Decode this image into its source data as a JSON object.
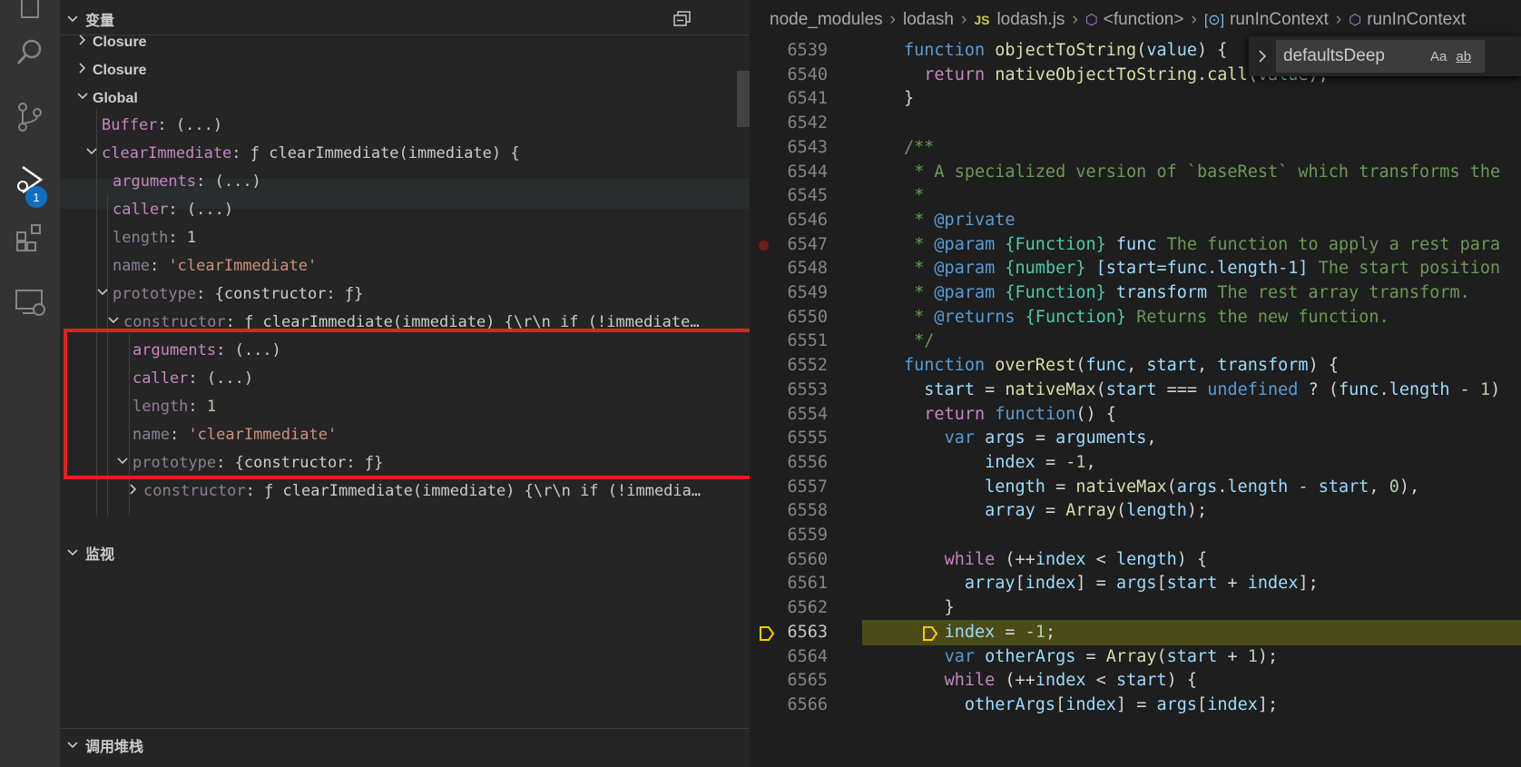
{
  "activity": {
    "badge": "1"
  },
  "variables_panel": {
    "header": "变量",
    "rows": [
      {
        "type": "scope",
        "label": "Closure"
      },
      {
        "type": "scope",
        "label": "Closure"
      },
      {
        "type": "scope",
        "label": "Global"
      },
      {
        "key": "Buffer",
        "value": "(...)"
      },
      {
        "key": "clearImmediate",
        "value": "ƒ clearImmediate(immediate) {"
      },
      {
        "key": "arguments",
        "value": "(...)"
      },
      {
        "key": "caller",
        "value": "(...)"
      },
      {
        "key": "length",
        "value": "1"
      },
      {
        "key": "name",
        "value": "'clearImmediate'"
      },
      {
        "key": "prototype",
        "value": "{constructor: ƒ}"
      },
      {
        "key": "constructor",
        "value": "ƒ clearImmediate(immediate) {\\r\\n  if (!immediate…"
      },
      {
        "key": "arguments",
        "value": "(...)"
      },
      {
        "key": "caller",
        "value": "(...)"
      },
      {
        "key": "length",
        "value": "1"
      },
      {
        "key": "name",
        "value": "'clearImmediate'"
      },
      {
        "key": "prototype",
        "value": "{constructor: ƒ}"
      },
      {
        "key": "constructor",
        "value": "ƒ clearImmediate(immediate) {\\r\\n  if (!immedia…"
      }
    ]
  },
  "watch_panel": {
    "header": "监视"
  },
  "callstack_panel": {
    "header": "调用堆栈"
  },
  "breadcrumb": {
    "items": [
      "node_modules",
      "lodash",
      "lodash.js",
      "<function>",
      "runInContext",
      "runInContext"
    ],
    "js_badge": "JS"
  },
  "find_widget": {
    "value": "defaultsDeep",
    "match_case": "Aa",
    "whole_word": "ab"
  },
  "code": {
    "line_numbers": [
      "6539",
      "6540",
      "6541",
      "6542",
      "6543",
      "6544",
      "6545",
      "6546",
      "6547",
      "6548",
      "6549",
      "6550",
      "6551",
      "6552",
      "6553",
      "6554",
      "6555",
      "6556",
      "6557",
      "6558",
      "6559",
      "6560",
      "6561",
      "6562",
      "6563",
      "6564",
      "6565",
      "6566"
    ],
    "breakpoint_line": "6547",
    "current_line": "6563",
    "lines": [
      [
        [
          "kw",
          "function "
        ],
        [
          "fn",
          "objectToString"
        ],
        [
          "pl",
          "("
        ],
        [
          "var",
          "value"
        ],
        [
          "pl",
          ") {"
        ]
      ],
      [
        [
          "pl",
          "  "
        ],
        [
          "ctl",
          "return "
        ],
        [
          "fn",
          "nativeObjectToString"
        ],
        [
          "pl",
          "."
        ],
        [
          "fn",
          "call"
        ],
        [
          "pl",
          "("
        ],
        [
          "var",
          "value"
        ],
        [
          "pl",
          ");"
        ]
      ],
      [
        [
          "pl",
          "}"
        ]
      ],
      [],
      [
        [
          "cm",
          "/**"
        ]
      ],
      [
        [
          "cm",
          " * A specialized version of `baseRest` which transforms the"
        ]
      ],
      [
        [
          "cm",
          " *"
        ]
      ],
      [
        [
          "cm",
          " * "
        ],
        [
          "doc",
          "@private"
        ]
      ],
      [
        [
          "cm",
          " * "
        ],
        [
          "doc",
          "@param "
        ],
        [
          "ty",
          "{Function} "
        ],
        [
          "var",
          "func "
        ],
        [
          "cm",
          "The function to apply a rest para"
        ]
      ],
      [
        [
          "cm",
          " * "
        ],
        [
          "doc",
          "@param "
        ],
        [
          "ty",
          "{number} "
        ],
        [
          "var",
          "[start=func.length-1] "
        ],
        [
          "cm",
          "The start position"
        ]
      ],
      [
        [
          "cm",
          " * "
        ],
        [
          "doc",
          "@param "
        ],
        [
          "ty",
          "{Function} "
        ],
        [
          "var",
          "transform "
        ],
        [
          "cm",
          "The rest array transform."
        ]
      ],
      [
        [
          "cm",
          " * "
        ],
        [
          "doc",
          "@returns "
        ],
        [
          "ty",
          "{Function} "
        ],
        [
          "cm",
          "Returns the new function."
        ]
      ],
      [
        [
          "cm",
          " */"
        ]
      ],
      [
        [
          "kw",
          "function "
        ],
        [
          "fn",
          "overRest"
        ],
        [
          "pl",
          "("
        ],
        [
          "var",
          "func"
        ],
        [
          "pl",
          ", "
        ],
        [
          "var",
          "start"
        ],
        [
          "pl",
          ", "
        ],
        [
          "var",
          "transform"
        ],
        [
          "pl",
          ") {"
        ]
      ],
      [
        [
          "pl",
          "  "
        ],
        [
          "var",
          "start"
        ],
        [
          "pl",
          " = "
        ],
        [
          "fn",
          "nativeMax"
        ],
        [
          "pl",
          "("
        ],
        [
          "var",
          "start"
        ],
        [
          "pl",
          " === "
        ],
        [
          "kw",
          "undefined"
        ],
        [
          "pl",
          " ? ("
        ],
        [
          "var",
          "func"
        ],
        [
          "pl",
          "."
        ],
        [
          "var",
          "length"
        ],
        [
          "pl",
          " - "
        ],
        [
          "num",
          "1"
        ],
        [
          "pl",
          ")"
        ]
      ],
      [
        [
          "pl",
          "  "
        ],
        [
          "ctl",
          "return "
        ],
        [
          "kw",
          "function"
        ],
        [
          "pl",
          "() {"
        ]
      ],
      [
        [
          "pl",
          "    "
        ],
        [
          "kw",
          "var "
        ],
        [
          "var",
          "args"
        ],
        [
          "pl",
          " = "
        ],
        [
          "var",
          "arguments"
        ],
        [
          "pl",
          ","
        ]
      ],
      [
        [
          "pl",
          "        "
        ],
        [
          "var",
          "index"
        ],
        [
          "pl",
          " = -"
        ],
        [
          "num",
          "1"
        ],
        [
          "pl",
          ","
        ]
      ],
      [
        [
          "pl",
          "        "
        ],
        [
          "var",
          "length"
        ],
        [
          "pl",
          " = "
        ],
        [
          "fn",
          "nativeMax"
        ],
        [
          "pl",
          "("
        ],
        [
          "var",
          "args"
        ],
        [
          "pl",
          "."
        ],
        [
          "var",
          "length"
        ],
        [
          "pl",
          " - "
        ],
        [
          "var",
          "start"
        ],
        [
          "pl",
          ", "
        ],
        [
          "num",
          "0"
        ],
        [
          "pl",
          "),"
        ]
      ],
      [
        [
          "pl",
          "        "
        ],
        [
          "var",
          "array"
        ],
        [
          "pl",
          " = "
        ],
        [
          "fn",
          "Array"
        ],
        [
          "pl",
          "("
        ],
        [
          "var",
          "length"
        ],
        [
          "pl",
          ");"
        ]
      ],
      [],
      [
        [
          "pl",
          "    "
        ],
        [
          "ctl",
          "while "
        ],
        [
          "pl",
          "(++"
        ],
        [
          "var",
          "index"
        ],
        [
          "pl",
          " < "
        ],
        [
          "var",
          "length"
        ],
        [
          "pl",
          ") {"
        ]
      ],
      [
        [
          "pl",
          "      "
        ],
        [
          "var",
          "array"
        ],
        [
          "pl",
          "["
        ],
        [
          "var",
          "index"
        ],
        [
          "pl",
          "] = "
        ],
        [
          "var",
          "args"
        ],
        [
          "pl",
          "["
        ],
        [
          "var",
          "start"
        ],
        [
          "pl",
          " + "
        ],
        [
          "var",
          "index"
        ],
        [
          "pl",
          "];"
        ]
      ],
      [
        [
          "pl",
          "    }"
        ]
      ],
      [
        [
          "pl",
          "    "
        ],
        [
          "var",
          "index"
        ],
        [
          "pl",
          " = -"
        ],
        [
          "num",
          "1"
        ],
        [
          "pl",
          ";"
        ]
      ],
      [
        [
          "pl",
          "    "
        ],
        [
          "kw",
          "var "
        ],
        [
          "var",
          "otherArgs"
        ],
        [
          "pl",
          " = "
        ],
        [
          "fn",
          "Array"
        ],
        [
          "pl",
          "("
        ],
        [
          "var",
          "start"
        ],
        [
          "pl",
          " + "
        ],
        [
          "num",
          "1"
        ],
        [
          "pl",
          ");"
        ]
      ],
      [
        [
          "pl",
          "    "
        ],
        [
          "ctl",
          "while "
        ],
        [
          "pl",
          "(++"
        ],
        [
          "var",
          "index"
        ],
        [
          "pl",
          " < "
        ],
        [
          "var",
          "start"
        ],
        [
          "pl",
          ") {"
        ]
      ],
      [
        [
          "pl",
          "      "
        ],
        [
          "var",
          "otherArgs"
        ],
        [
          "pl",
          "["
        ],
        [
          "var",
          "index"
        ],
        [
          "pl",
          "] = "
        ],
        [
          "var",
          "args"
        ],
        [
          "pl",
          "["
        ],
        [
          "var",
          "index"
        ],
        [
          "pl",
          "];"
        ]
      ]
    ]
  },
  "icons": [
    "files-icon",
    "search-icon",
    "source-control-icon",
    "run-debug-icon",
    "extensions-icon",
    "remote-explorer-icon",
    "collapse-all-icon"
  ],
  "colors": {
    "highlight_box": "#e51f1f",
    "current_line_bg": "#4b4b18",
    "badge": "#0e70c0"
  }
}
